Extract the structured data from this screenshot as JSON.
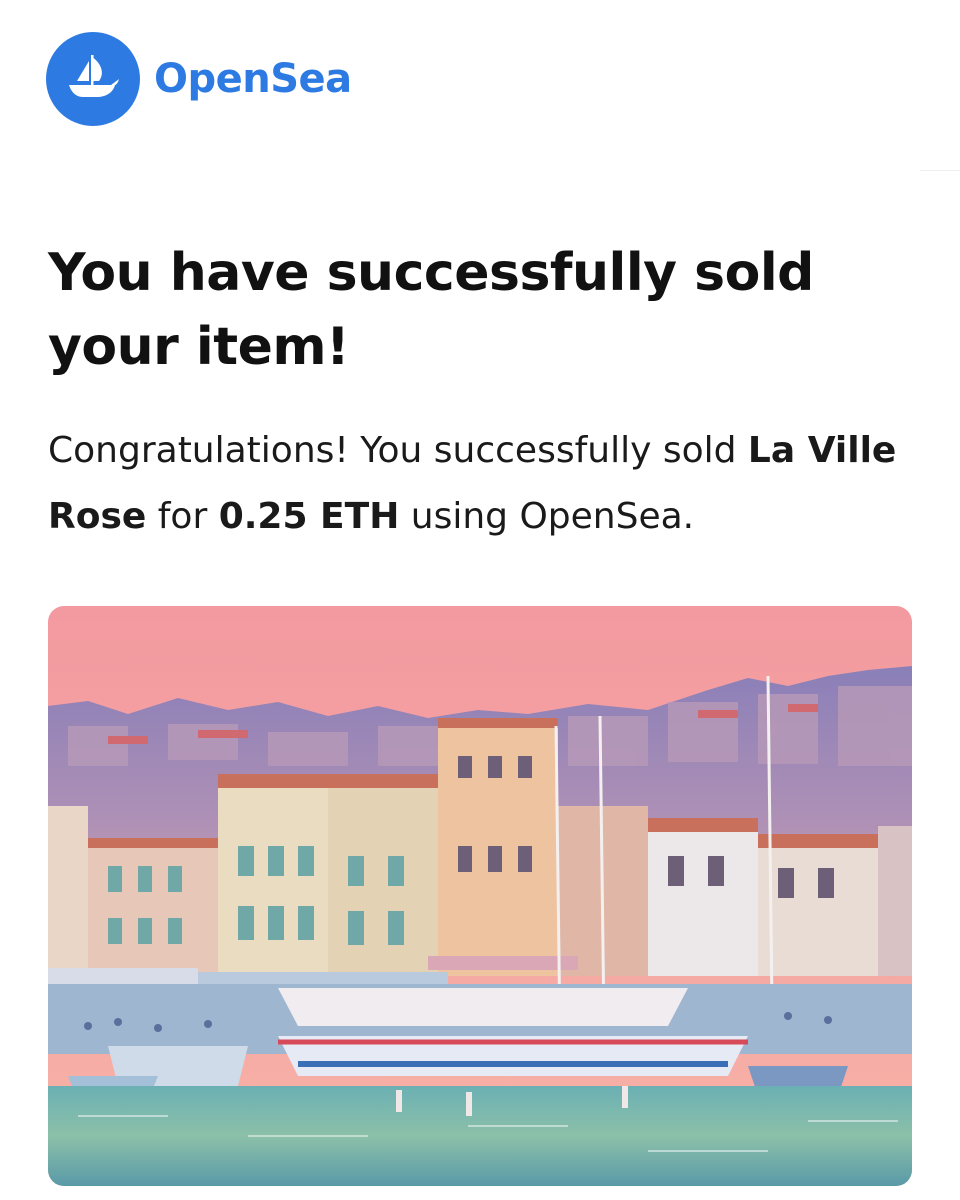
{
  "brand": {
    "name": "OpenSea",
    "logo_icon": "opensea-ship-icon",
    "color": "#2d7be2"
  },
  "headline": "You have successfully sold your item!",
  "message": {
    "prefix": "Congratulations! You successfully sold ",
    "item_name": "La Ville Rose",
    "middle": " for ",
    "price": "0.25 ETH",
    "suffix": " using OpenSea."
  },
  "item_image": {
    "icon": "harbor-town-artwork",
    "sky_color": "#f2a0a4"
  }
}
